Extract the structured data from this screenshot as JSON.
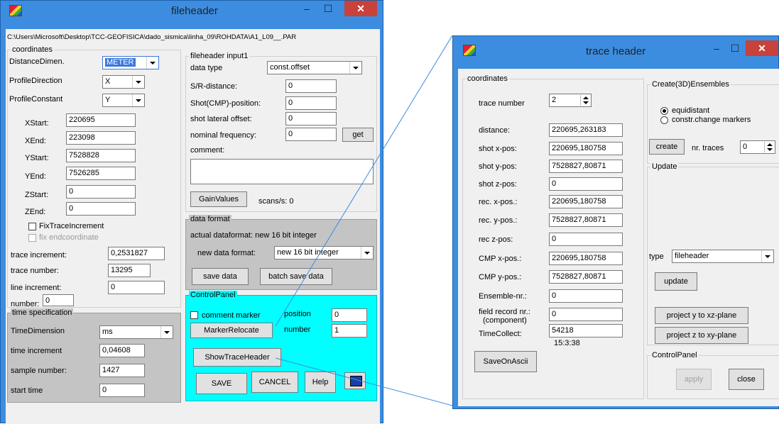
{
  "fileheader": {
    "title": "fileheader",
    "path": "C:\\Users\\Microsoft\\Desktop\\TCC-GEOFISICA\\dado_sismica\\linha_09\\ROHDATA\\A1_L09__.PAR",
    "coordinates": {
      "group": "coordinates",
      "distance_dimen_label": "DistanceDimen.",
      "distance_dimen_value": "METER",
      "profile_direction_label": "ProfileDirection",
      "profile_direction_value": "X",
      "profile_constant_label": "ProfileConstant",
      "profile_constant_value": "Y",
      "xstart_label": "XStart:",
      "xstart": "220695",
      "xend_label": "XEnd:",
      "xend": "223098",
      "ystart_label": "YStart:",
      "ystart": "7528828",
      "yend_label": "YEnd:",
      "yend": "7526285",
      "zstart_label": "ZStart:",
      "zstart": "0",
      "zend_label": "ZEnd:",
      "zend": "0",
      "fix_trace_increment": "FixTraceIncrement",
      "fix_endcoordinate": "fix endcoordinate",
      "trace_increment_label": "trace increment:",
      "trace_increment": "0,2531827",
      "trace_number_label": "trace number:",
      "trace_number": "13295",
      "line_increment_label": "line increment:",
      "line_increment": "0",
      "number_label": "number:",
      "number": "0"
    },
    "time_spec": {
      "group": "time specification",
      "time_dimension_label": "TimeDimension",
      "time_dimension": "ms",
      "time_increment_label": "time increment",
      "time_increment": "0,04608",
      "sample_number_label": "sample number:",
      "sample_number": "1427",
      "start_time_label": "start time",
      "start_time": "0"
    },
    "input1": {
      "group": "fileheader input1",
      "data_type_label": "data type",
      "data_type": "const.offset",
      "sr_distance_label": "S/R-distance:",
      "sr_distance": "0",
      "shot_cmp_label": "Shot(CMP)-position:",
      "shot_cmp": "0",
      "shot_lateral_label": "shot lateral offset:",
      "shot_lateral": "0",
      "nominal_freq_label": "nominal frequency:",
      "nominal_freq": "0",
      "get_button": "get",
      "comment_label": "comment:",
      "comment": "",
      "gain_values_button": "GainValues",
      "scans_label": "scans/s: 0"
    },
    "data_format": {
      "group": "data format",
      "actual": "actual dataformat: new 16 bit integer",
      "new_label": "new data format:",
      "new_value": "new 16 bit integer",
      "save_data": "save data",
      "batch_save_data": "batch save data"
    },
    "control_panel": {
      "group": "ControlPanel",
      "comment_marker": "comment marker",
      "position_label": "position",
      "position": "0",
      "number_label": "number",
      "number": "1",
      "marker_relocate": "MarkerRelocate",
      "show_trace_header": "ShowTraceHeader",
      "save": "SAVE",
      "cancel": "CANCEL",
      "help": "Help"
    }
  },
  "traceheader": {
    "title": "trace header",
    "coordinates": {
      "group": "coordinates",
      "trace_number_label": "trace number",
      "trace_number": "2",
      "distance_label": "distance:",
      "distance": "220695,263183",
      "shot_x_label": "shot x-pos:",
      "shot_x": "220695,180758",
      "shot_y_label": "shot y-pos:",
      "shot_y": "7528827,80871",
      "shot_z_label": "shot z-pos:",
      "shot_z": "0",
      "rec_x_label": "rec. x-pos.:",
      "rec_x": "220695,180758",
      "rec_y_label": "rec. y-pos.:",
      "rec_y": "7528827,80871",
      "rec_z_label": "rec z-pos:",
      "rec_z": "0",
      "cmp_x_label": "CMP x-pos.:",
      "cmp_x": "220695,180758",
      "cmp_y_label": "CMP y-pos.:",
      "cmp_y": "7528827,80871",
      "ensemble_label": "Ensemble-nr.:",
      "ensemble": "0",
      "field_record_label_1": "field record nr.:",
      "field_record_label_2": "(component)",
      "field_record": "0",
      "time_collect_label": "TimeCollect:",
      "time_collect": "54218",
      "time_collect_sub": "15:3:38",
      "save_on_ascii": "SaveOnAscii"
    },
    "create3d": {
      "group": "Create(3D)Ensembles",
      "equidistant": "equidistant",
      "constr_change": "constr.change markers",
      "create": "create",
      "nr_traces_label": "nr. traces",
      "nr_traces": "0"
    },
    "update": {
      "group": "Update",
      "type_label": "type",
      "type_value": "fileheader",
      "update_button": "update",
      "project_y": "project y to xz-plane",
      "project_z": "project z to xy-plane"
    },
    "control_panel": {
      "group": "ControlPanel",
      "apply": "apply",
      "close": "close"
    }
  },
  "colors": {
    "titlebar": "#3c8de0",
    "cyan_panel": "#00ffff",
    "close_red": "#c8413a"
  }
}
